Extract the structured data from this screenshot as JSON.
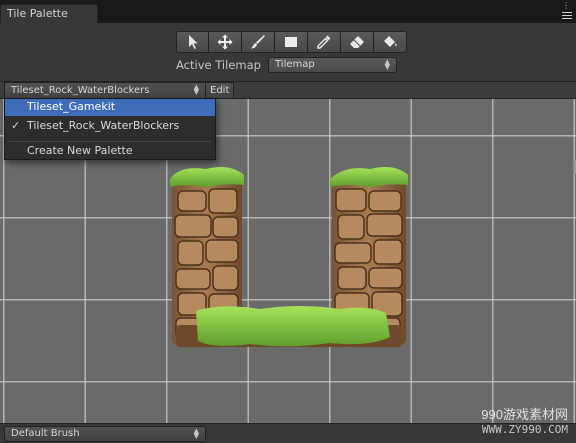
{
  "window": {
    "tab_title": "Tile Palette",
    "menu_dots": "⋮"
  },
  "toolbar": {
    "tools": [
      {
        "name": "select-tool",
        "icon": "cursor-arrow-icon"
      },
      {
        "name": "move-tool",
        "icon": "move-arrows-icon"
      },
      {
        "name": "paint-tool",
        "icon": "paintbrush-icon"
      },
      {
        "name": "box-fill-tool",
        "icon": "box-fill-icon"
      },
      {
        "name": "picker-tool",
        "icon": "eyedropper-icon"
      },
      {
        "name": "erase-tool",
        "icon": "eraser-icon"
      },
      {
        "name": "flood-fill-tool",
        "icon": "paint-bucket-icon"
      }
    ],
    "active_tilemap_label": "Active Tilemap",
    "active_tilemap_value": "Tilemap"
  },
  "palette": {
    "selected": "Tileset_Rock_WaterBlockers",
    "edit_label": "Edit"
  },
  "dropdown": {
    "items": [
      {
        "label": "Tileset_Gamekit",
        "highlighted": true,
        "checked": false
      },
      {
        "label": "Tileset_Rock_WaterBlockers",
        "highlighted": false,
        "checked": true
      }
    ],
    "check_glyph": "✓",
    "create_label": "Create New Palette"
  },
  "bottom": {
    "brush": "Default Brush"
  },
  "watermark": {
    "line1": "990游戏素材网",
    "line2": "WWW.ZY990.COM"
  },
  "colors": {
    "grass_light": "#8fd14a",
    "grass_dark": "#5a9a2a",
    "rock_light": "#b08357",
    "rock_dark": "#6e4a2c",
    "grid_bg": "#6a6a6a",
    "highlight": "#3e6cb8"
  }
}
